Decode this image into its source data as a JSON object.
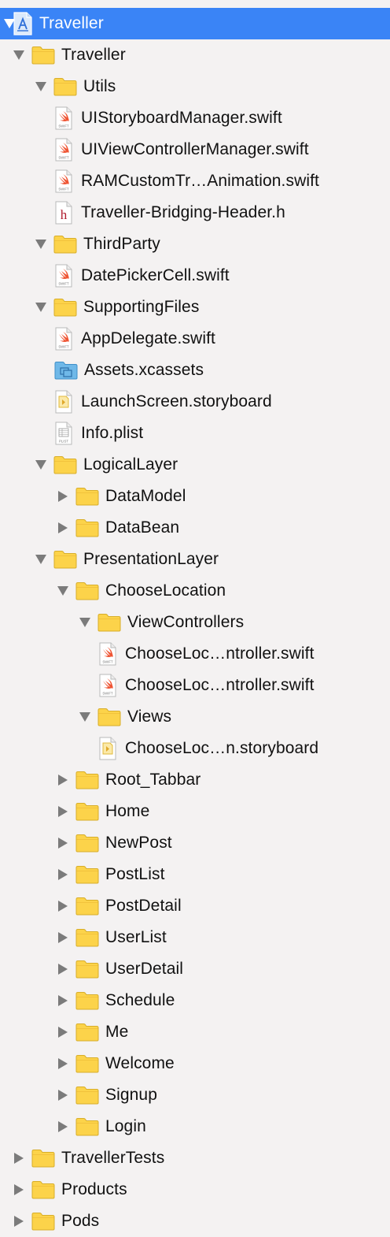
{
  "navigator": {
    "accent_color": "#3a84f6",
    "folder_color": "#fcd34a",
    "items": [
      {
        "label": "Traveller",
        "level": 0,
        "kind": "project",
        "disclosure": "expanded",
        "selected": true
      },
      {
        "label": "Traveller",
        "level": 1,
        "kind": "folder",
        "disclosure": "expanded"
      },
      {
        "label": "Utils",
        "level": 2,
        "kind": "folder",
        "disclosure": "expanded"
      },
      {
        "label": "UIStoryboardManager.swift",
        "level": 3,
        "kind": "swift"
      },
      {
        "label": "UIViewControllerManager.swift",
        "level": 3,
        "kind": "swift"
      },
      {
        "label": "RAMCustomTr…Animation.swift",
        "level": 3,
        "kind": "swift"
      },
      {
        "label": "Traveller-Bridging-Header.h",
        "level": 3,
        "kind": "header"
      },
      {
        "label": "ThirdParty",
        "level": 2,
        "kind": "folder",
        "disclosure": "expanded"
      },
      {
        "label": "DatePickerCell.swift",
        "level": 3,
        "kind": "swift"
      },
      {
        "label": "SupportingFiles",
        "level": 2,
        "kind": "folder",
        "disclosure": "expanded"
      },
      {
        "label": "AppDelegate.swift",
        "level": 3,
        "kind": "swift"
      },
      {
        "label": "Assets.xcassets",
        "level": 3,
        "kind": "assets"
      },
      {
        "label": "LaunchScreen.storyboard",
        "level": 3,
        "kind": "storyboard"
      },
      {
        "label": "Info.plist",
        "level": 3,
        "kind": "plist"
      },
      {
        "label": "LogicalLayer",
        "level": 2,
        "kind": "folder",
        "disclosure": "expanded"
      },
      {
        "label": "DataModel",
        "level": 3,
        "kind": "folder",
        "disclosure": "collapsed"
      },
      {
        "label": "DataBean",
        "level": 3,
        "kind": "folder",
        "disclosure": "collapsed"
      },
      {
        "label": "PresentationLayer",
        "level": 2,
        "kind": "folder",
        "disclosure": "expanded"
      },
      {
        "label": "ChooseLocation",
        "level": 3,
        "kind": "folder",
        "disclosure": "expanded"
      },
      {
        "label": "ViewControllers",
        "level": 4,
        "kind": "folder",
        "disclosure": "expanded"
      },
      {
        "label": "ChooseLoc…ntroller.swift",
        "level": 5,
        "kind": "swift"
      },
      {
        "label": "ChooseLoc…ntroller.swift",
        "level": 5,
        "kind": "swift"
      },
      {
        "label": "Views",
        "level": 4,
        "kind": "folder",
        "disclosure": "expanded"
      },
      {
        "label": "ChooseLoc…n.storyboard",
        "level": 5,
        "kind": "storyboard"
      },
      {
        "label": "Root_Tabbar",
        "level": 3,
        "kind": "folder",
        "disclosure": "collapsed"
      },
      {
        "label": "Home",
        "level": 3,
        "kind": "folder",
        "disclosure": "collapsed"
      },
      {
        "label": "NewPost",
        "level": 3,
        "kind": "folder",
        "disclosure": "collapsed"
      },
      {
        "label": "PostList",
        "level": 3,
        "kind": "folder",
        "disclosure": "collapsed"
      },
      {
        "label": "PostDetail",
        "level": 3,
        "kind": "folder",
        "disclosure": "collapsed"
      },
      {
        "label": "UserList",
        "level": 3,
        "kind": "folder",
        "disclosure": "collapsed"
      },
      {
        "label": "UserDetail",
        "level": 3,
        "kind": "folder",
        "disclosure": "collapsed"
      },
      {
        "label": "Schedule",
        "level": 3,
        "kind": "folder",
        "disclosure": "collapsed"
      },
      {
        "label": "Me",
        "level": 3,
        "kind": "folder",
        "disclosure": "collapsed"
      },
      {
        "label": "Welcome",
        "level": 3,
        "kind": "folder",
        "disclosure": "collapsed"
      },
      {
        "label": "Signup",
        "level": 3,
        "kind": "folder",
        "disclosure": "collapsed"
      },
      {
        "label": "Login",
        "level": 3,
        "kind": "folder",
        "disclosure": "collapsed"
      },
      {
        "label": "TravellerTests",
        "level": 1,
        "kind": "folder",
        "disclosure": "collapsed"
      },
      {
        "label": "Products",
        "level": 1,
        "kind": "folder",
        "disclosure": "collapsed"
      },
      {
        "label": "Pods",
        "level": 1,
        "kind": "folder",
        "disclosure": "collapsed"
      }
    ]
  }
}
